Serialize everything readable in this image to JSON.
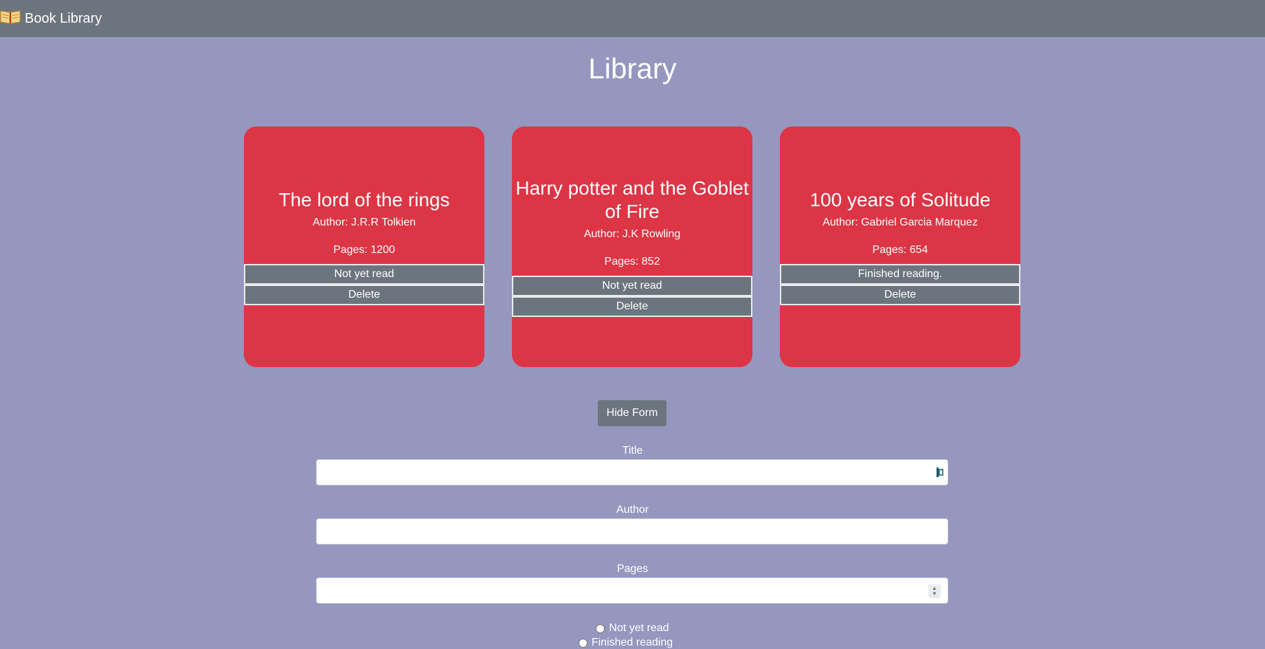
{
  "nav": {
    "brand_text": "Book Library",
    "brand_icon": "open-book-icon"
  },
  "page": {
    "title": "Library"
  },
  "books": [
    {
      "title": "The lord of the rings",
      "author": "Author: J.R.R Tolkien",
      "pages": "Pages: 1200",
      "status_label": "Not yet read",
      "delete_label": "Delete"
    },
    {
      "title": "Harry potter and the Goblet of Fire",
      "author": "Author: J.K Rowling",
      "pages": "Pages: 852",
      "status_label": "Not yet read",
      "delete_label": "Delete"
    },
    {
      "title": "100 years of Solitude",
      "author": "Author: Gabriel Garcia Marquez",
      "pages": "Pages: 654",
      "status_label": "Finished reading.",
      "delete_label": "Delete"
    }
  ],
  "form": {
    "toggle_label": "Hide Form",
    "title_label": "Title",
    "title_value": "",
    "author_label": "Author",
    "author_value": "",
    "pages_label": "Pages",
    "pages_value": "",
    "radio_not_read_label": "Not yet read",
    "radio_finished_label": "Finished reading"
  },
  "colors": {
    "background": "#9597bf",
    "navbar": "#6c757d",
    "card": "#dc3545",
    "button": "#6c757d"
  }
}
